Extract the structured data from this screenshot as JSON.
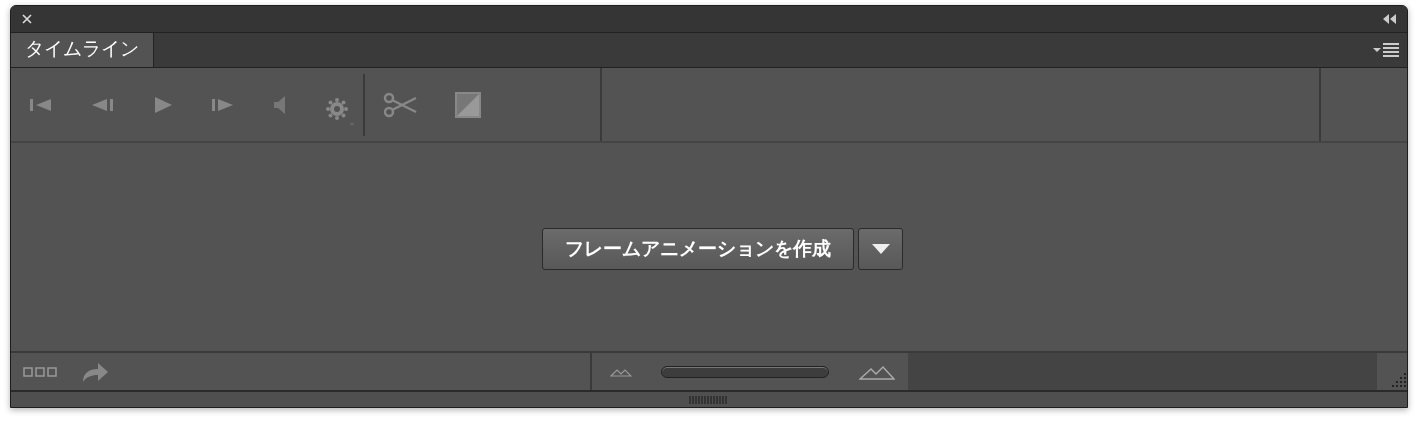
{
  "panel": {
    "tabs": [
      {
        "label": "タイムライン",
        "selected": true
      }
    ]
  },
  "create_button": {
    "label": "フレームアニメーションを作成"
  }
}
